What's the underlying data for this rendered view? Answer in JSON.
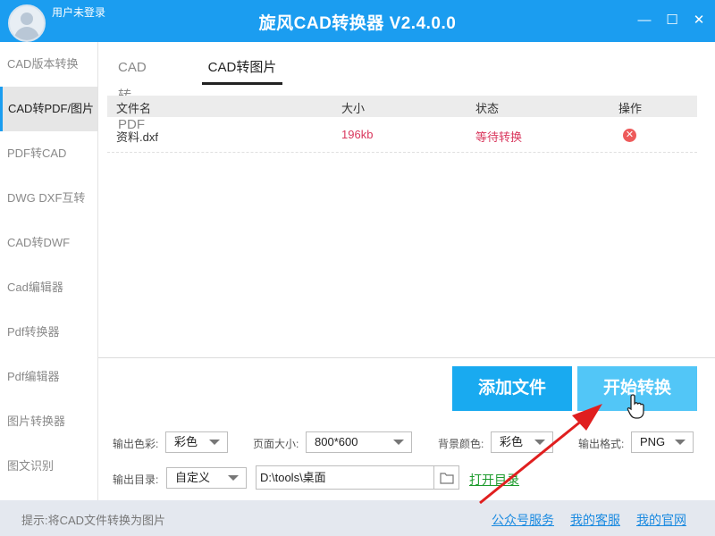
{
  "titlebar": {
    "user_label": "用户未登录",
    "title": "旋风CAD转换器 V2.4.0.0",
    "min_glyph": "—",
    "max_glyph": "☐",
    "close_glyph": "✕"
  },
  "sidebar": {
    "items": [
      {
        "label": "CAD版本转换"
      },
      {
        "label": "CAD转PDF/图片",
        "active": true
      },
      {
        "label": "PDF转CAD"
      },
      {
        "label": "DWG DXF互转"
      },
      {
        "label": "CAD转DWF"
      },
      {
        "label": "Cad编辑器"
      },
      {
        "label": "Pdf转换器"
      },
      {
        "label": "Pdf编辑器"
      },
      {
        "label": "图片转换器"
      },
      {
        "label": "图文识别"
      }
    ]
  },
  "tabs": [
    {
      "label": "CAD转PDF"
    },
    {
      "label": "CAD转图片",
      "active": true
    }
  ],
  "table": {
    "headers": {
      "name": "文件名",
      "size": "大小",
      "status": "状态",
      "op": "操作"
    },
    "rows": [
      {
        "name": "资料.dxf",
        "size": "196kb",
        "status": "等待转换",
        "op_icon": "delete-icon"
      }
    ]
  },
  "buttons": {
    "add_file": "添加文件",
    "start": "开始转换"
  },
  "options": {
    "color_label": "输出色彩:",
    "color_value": "彩色",
    "page_size_label": "页面大小:",
    "page_size_value": "800*600",
    "bg_color_label": "背景颜色:",
    "bg_color_value": "彩色",
    "format_label": "输出格式:",
    "format_value": "PNG",
    "dir_label": "输出目录:",
    "dir_mode_value": "自定义",
    "dir_path": "D:\\tools\\桌面",
    "open_dir": "打开目录"
  },
  "statusbar": {
    "tip": "提示:将CAD文件转换为图片",
    "links": [
      "公众号服务",
      "我的客服",
      "我的官网"
    ]
  },
  "colors": {
    "accent": "#1b9df0",
    "add_button": "#19aaf0",
    "start_button": "#52c6f7",
    "status_text": "#d9375d",
    "open_dir_link": "#1d9b2d",
    "annotation_arrow": "#e01f1f"
  }
}
